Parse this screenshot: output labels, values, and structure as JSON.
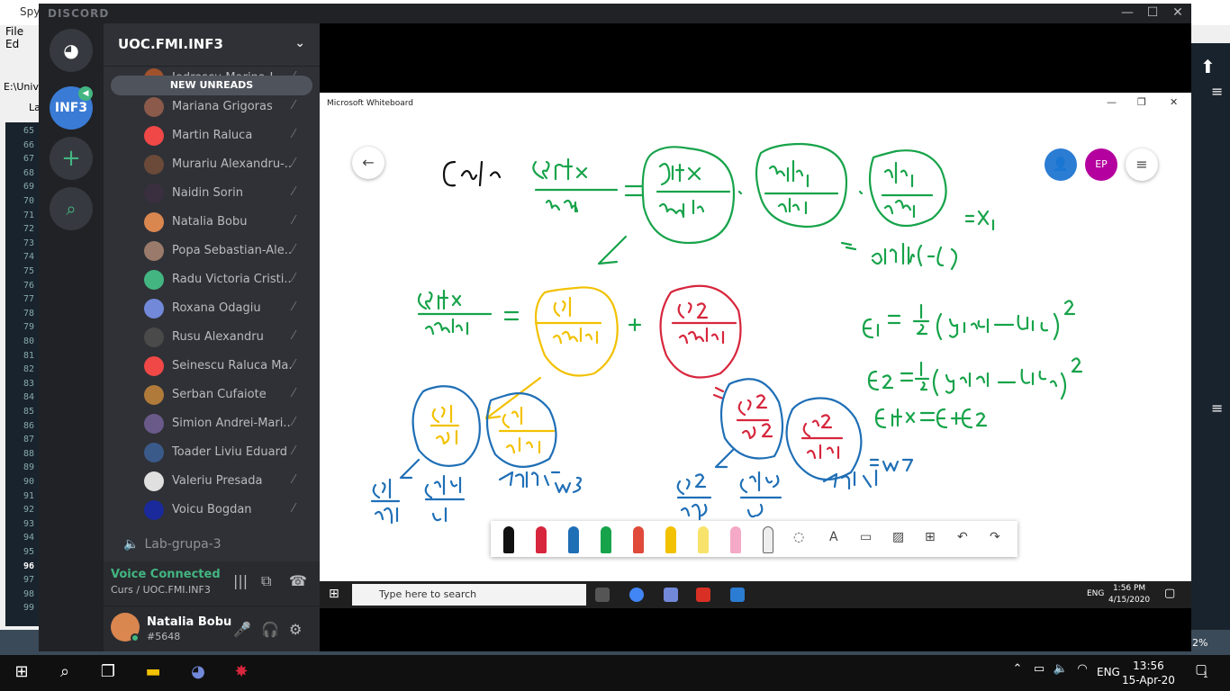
{
  "spyder": {
    "title": "Spy",
    "menu": [
      "File",
      "Ed"
    ],
    "path": "E:\\Univ",
    "tab": "La",
    "line_numbers": [
      "65",
      "66",
      "67",
      "68",
      "69",
      "70",
      "71",
      "72",
      "73",
      "74",
      "75",
      "76",
      "77",
      "78",
      "79",
      "80",
      "81",
      "82",
      "83",
      "84",
      "85",
      "86",
      "87",
      "88",
      "89",
      "90",
      "91",
      "92",
      "93",
      "94",
      "95",
      "96",
      "97",
      "98",
      "99"
    ],
    "status_pct": "2%"
  },
  "discord": {
    "app_name": "DISCORD",
    "server": "UOC.FMI.INF3",
    "guild_label": "INF3",
    "new_unreads": "NEW UNREADS",
    "members": [
      {
        "name": "Iedrescu Marina-I...",
        "color": "#a0522d"
      },
      {
        "name": "Mariana Grigoras",
        "color": "#8b5a4a"
      },
      {
        "name": "Martin Raluca",
        "color": "#f04747"
      },
      {
        "name": "Murariu Alexandru-...",
        "color": "#6b4a3a"
      },
      {
        "name": "Naidin Sorin",
        "color": "#3a2f3f"
      },
      {
        "name": "Natalia Bobu",
        "color": "#d9864f"
      },
      {
        "name": "Popa Sebastian-Ale...",
        "color": "#9a7a6a"
      },
      {
        "name": "Radu Victoria Cristi...",
        "color": "#43b581"
      },
      {
        "name": "Roxana Odagiu",
        "color": "#7289da"
      },
      {
        "name": "Rusu Alexandru",
        "color": "#4a4a4a"
      },
      {
        "name": "Seinescu Raluca Ma...",
        "color": "#f04747"
      },
      {
        "name": "Serban Cufaiote",
        "color": "#b07a3a"
      },
      {
        "name": "Simion Andrei-Mari...",
        "color": "#6a5a8a"
      },
      {
        "name": "Toader Liviu Eduard",
        "color": "#3a5a8a"
      },
      {
        "name": "Valeriu Presada",
        "color": "#e0e0e0"
      },
      {
        "name": "Voicu Bogdan",
        "color": "#1a2a9a"
      }
    ],
    "voice_channel": "Lab-grupa-3",
    "voice_status": "Voice Connected",
    "voice_location": "Curs / UOC.FMI.INF3",
    "user_name": "Natalia Bobu",
    "user_tag": "#5648"
  },
  "whiteboard": {
    "title": "Microsoft Whiteboard",
    "avatar_initials": "EP",
    "taskbar_search": "Type here to search",
    "taskbar_lang": "ENG",
    "taskbar_time": "1:56 PM",
    "taskbar_date": "4/15/2020"
  },
  "host_taskbar": {
    "lang": "ENG",
    "time": "13:56",
    "date": "15-Apr-20",
    "notif_count": "1"
  },
  "colors": {
    "discord_green": "#43b581",
    "ink_green": "#17a34a",
    "ink_blue": "#1f6fb6",
    "ink_yellow": "#f2c100",
    "ink_red": "#d7263d"
  }
}
